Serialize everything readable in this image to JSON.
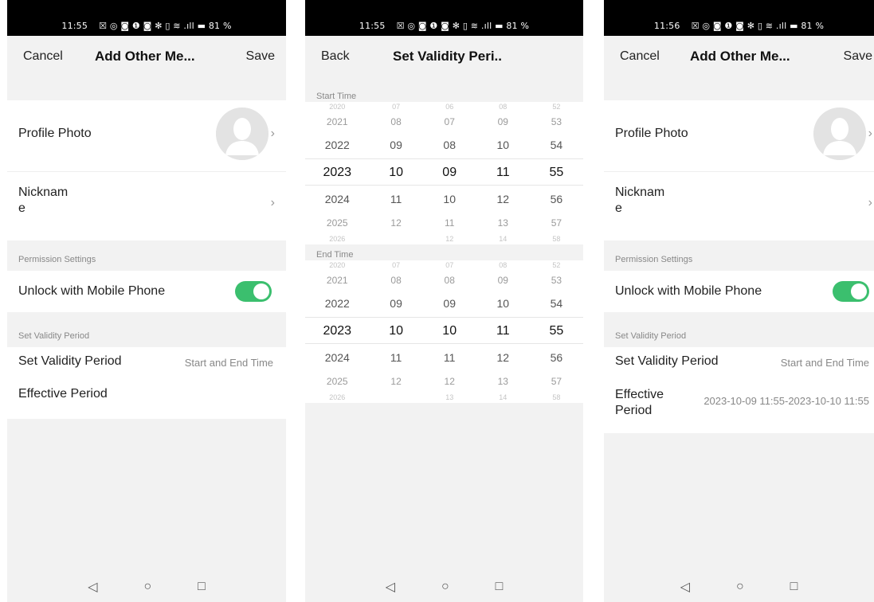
{
  "screens": [
    {
      "status": {
        "time": "11:55",
        "icons": "☒ ◎ ◙ ❶   ◙ ✻ ▯ ≋ .ıll ▬ 81 %"
      },
      "nav": {
        "left": "Cancel",
        "title": "Add Other Me...",
        "right": "Save"
      },
      "profile_photo_label": "Profile Photo",
      "nickname_label": "Nicknam\ne",
      "permission_section": "Permission Settings",
      "unlock_label": "Unlock with Mobile Phone",
      "unlock_enabled": true,
      "validity_section": "Set Validity Period",
      "validity_label": "Set Validity Period",
      "validity_value": "Start and End Time",
      "effective_label": "Effective Period",
      "effective_value": ""
    },
    {
      "status": {
        "time": "11:55",
        "icons": "☒ ◎ ◙ ❶   ◙ ✻ ▯ ≋ .ıll ▬ 81 %"
      },
      "nav": {
        "left": "Back",
        "title": "Set Validity Peri..",
        "right": ""
      },
      "start_label": "Start Time",
      "start_rows": [
        [
          "2020",
          "07",
          "06",
          "08",
          "52"
        ],
        [
          "2021",
          "08",
          "07",
          "09",
          "53"
        ],
        [
          "2022",
          "09",
          "08",
          "10",
          "54"
        ],
        [
          "2023",
          "10",
          "09",
          "11",
          "55"
        ],
        [
          "2024",
          "11",
          "10",
          "12",
          "56"
        ],
        [
          "2025",
          "12",
          "11",
          "13",
          "57"
        ],
        [
          "2026",
          "",
          "12",
          "14",
          "58"
        ]
      ],
      "end_label": "End Time",
      "end_rows": [
        [
          "2020",
          "07",
          "07",
          "08",
          "52"
        ],
        [
          "2021",
          "08",
          "08",
          "09",
          "53"
        ],
        [
          "2022",
          "09",
          "09",
          "10",
          "54"
        ],
        [
          "2023",
          "10",
          "10",
          "11",
          "55"
        ],
        [
          "2024",
          "11",
          "11",
          "12",
          "56"
        ],
        [
          "2025",
          "12",
          "12",
          "13",
          "57"
        ],
        [
          "2026",
          "",
          "13",
          "14",
          "58"
        ]
      ]
    },
    {
      "status": {
        "time": "11:56",
        "icons": "☒ ◎ ◙ ❶   ◙ ✻ ▯ ≋ .ıll ▬ 81 %"
      },
      "nav": {
        "left": "Cancel",
        "title": "Add Other Me...",
        "right": "Save"
      },
      "profile_photo_label": "Profile Photo",
      "nickname_label": "Nicknam\ne",
      "permission_section": "Permission Settings",
      "unlock_label": "Unlock with Mobile Phone",
      "unlock_enabled": true,
      "validity_section": "Set Validity Period",
      "validity_label": "Set Validity Period",
      "validity_value": "Start and End Time",
      "effective_label": "Effective\nPeriod",
      "effective_value": "2023-10-09 11:55-2023-10-10 11:55"
    }
  ],
  "system_nav": {
    "back": "◁",
    "home": "○",
    "recents": "□"
  },
  "colors": {
    "toggle_on": "#3bbf6e",
    "background": "#f2f2f2"
  }
}
